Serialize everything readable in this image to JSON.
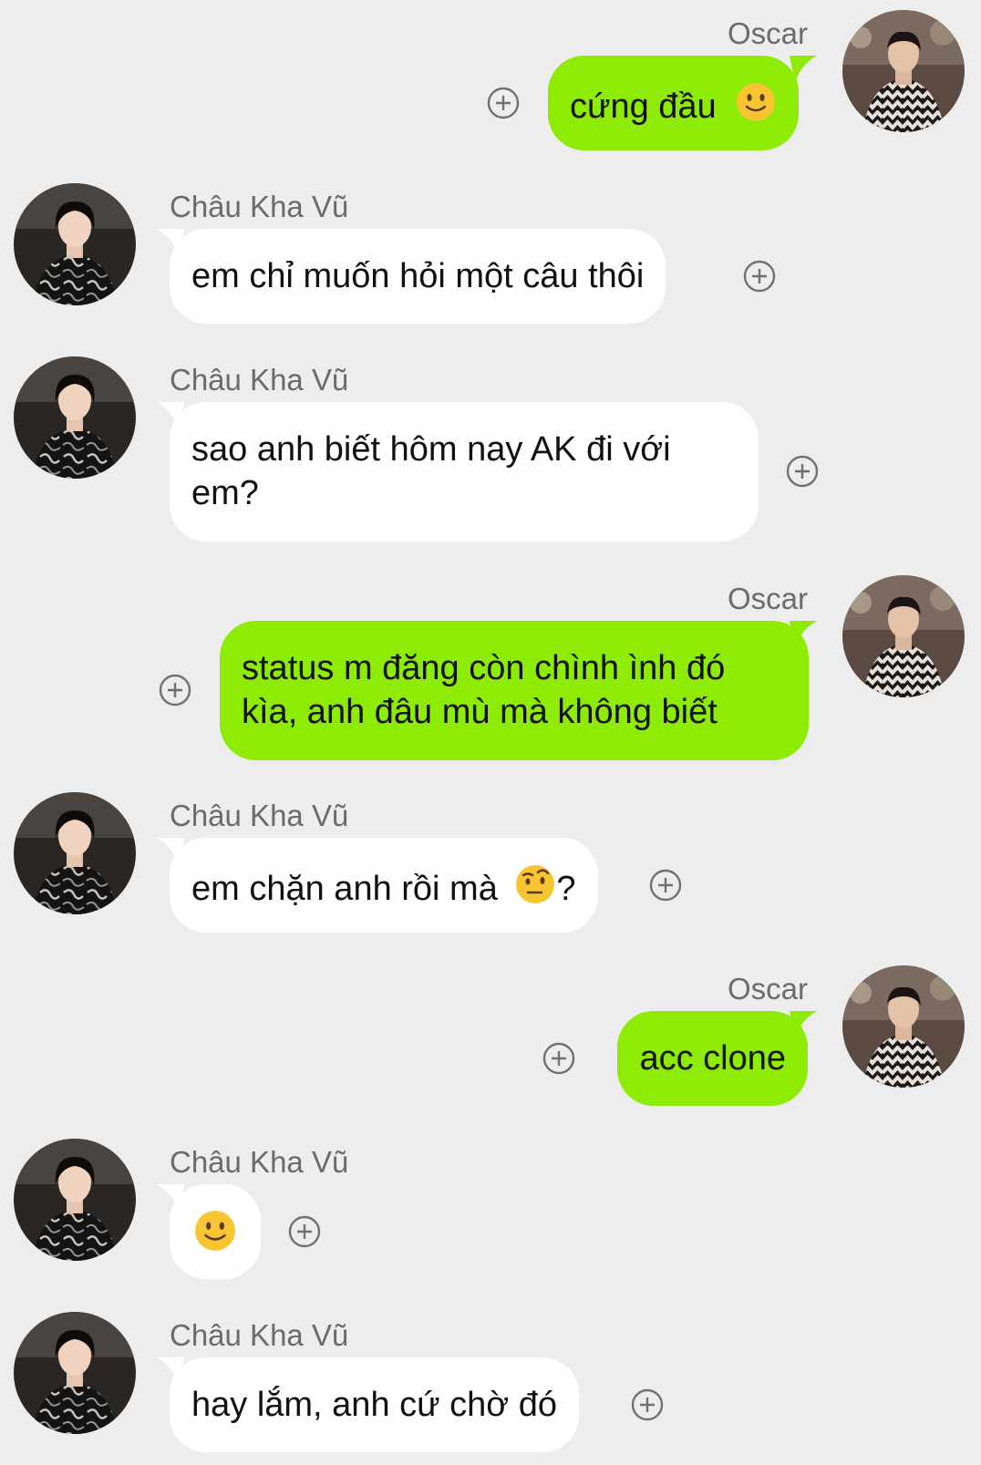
{
  "names": {
    "me": "Oscar",
    "other": "Châu Kha Vũ"
  },
  "colors": {
    "background": "#ededed",
    "sent_bubble": "#8deb06",
    "received_bubble": "#ffffff",
    "name_text": "#6b6b6b"
  },
  "messages": [
    {
      "from": "Oscar",
      "side": "right",
      "text": "cứng đầu",
      "emoji": "slightly-smiling-face"
    },
    {
      "from": "Châu Kha Vũ",
      "side": "left",
      "text": "em chỉ muốn hỏi một câu thôi"
    },
    {
      "from": "Châu Kha Vũ",
      "side": "left",
      "line1": "sao anh biết hôm nay AK đi với",
      "line2": "em?"
    },
    {
      "from": "Oscar",
      "side": "right",
      "line1": "status m đăng còn chình ình đó",
      "line2": "kìa, anh đâu mù mà không biết"
    },
    {
      "from": "Châu Kha Vũ",
      "side": "left",
      "text": "em chặn anh rồi mà",
      "emoji": "face-with-raised-eyebrow",
      "suffix": "?"
    },
    {
      "from": "Oscar",
      "side": "right",
      "text": "acc clone"
    },
    {
      "from": "Châu Kha Vũ",
      "side": "left",
      "emoji": "slightly-smiling-face"
    },
    {
      "from": "Châu Kha Vũ",
      "side": "left",
      "text": "hay lắm, anh cứ chờ đó"
    }
  ],
  "icons": {
    "add_reaction": "plus-circle-icon"
  }
}
